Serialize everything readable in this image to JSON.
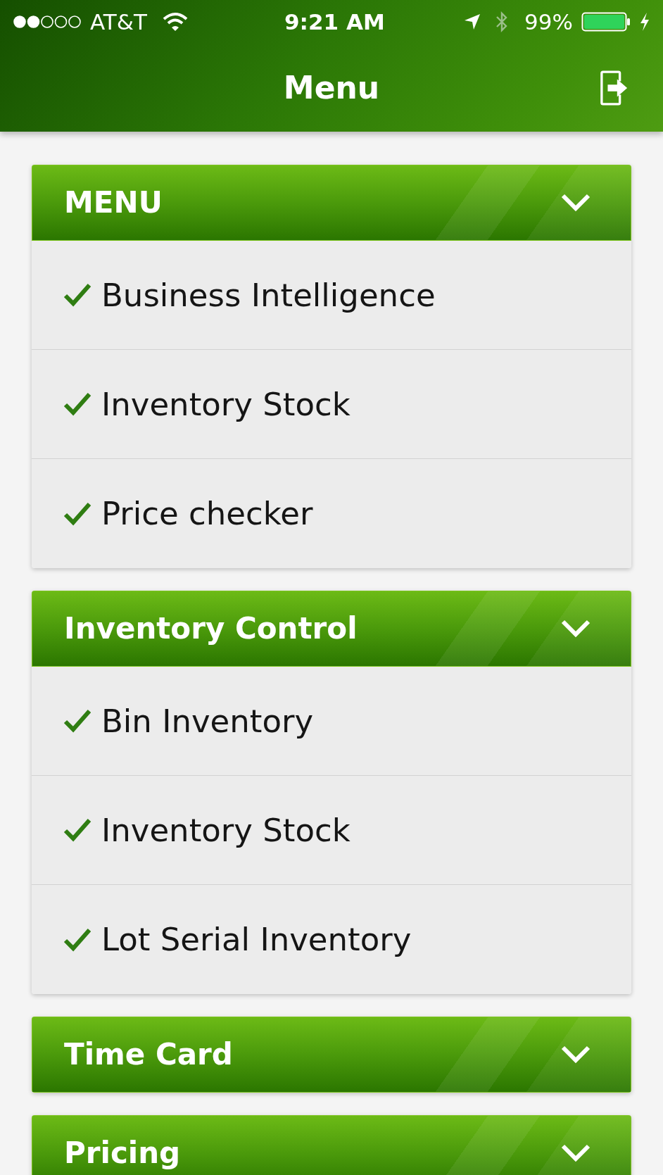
{
  "status_bar": {
    "carrier": "AT&T",
    "time": "9:21 AM",
    "battery": "99%"
  },
  "header": {
    "title": "Menu"
  },
  "sections": [
    {
      "title": "MENU",
      "items": [
        {
          "label": "Business Intelligence",
          "checked": true
        },
        {
          "label": "Inventory Stock",
          "checked": true
        },
        {
          "label": "Price checker",
          "checked": true
        }
      ]
    },
    {
      "title": "Inventory Control",
      "items": [
        {
          "label": "Bin Inventory",
          "checked": true
        },
        {
          "label": "Inventory Stock",
          "checked": true
        },
        {
          "label": "Lot Serial Inventory",
          "checked": true
        }
      ]
    },
    {
      "title": "Time Card"
    },
    {
      "title": "Pricing"
    }
  ]
}
